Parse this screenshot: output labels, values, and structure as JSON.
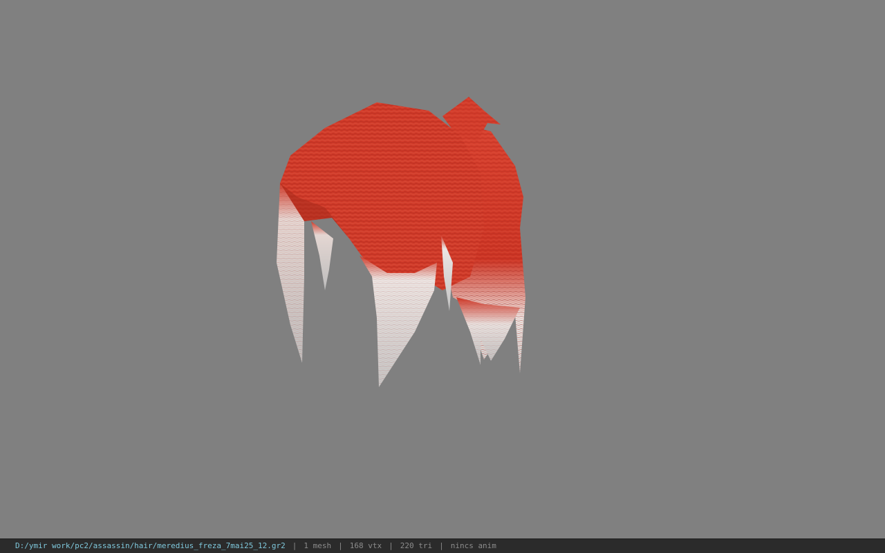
{
  "viewport": {
    "background_color": "#808080",
    "model_icon": "hair-mesh-model",
    "hair_color": "#d23a2a",
    "tip_color": "#d8d8d8"
  },
  "statusbar": {
    "file_path": "D:/ymir work/pc2/assassin/hair/meredius_freza_7mai25_12.gr2",
    "separator": "|",
    "mesh_count": "1 mesh",
    "vertex_count": "168 vtx",
    "triangle_count": "220 tri",
    "anim_status": "nincs anim"
  }
}
